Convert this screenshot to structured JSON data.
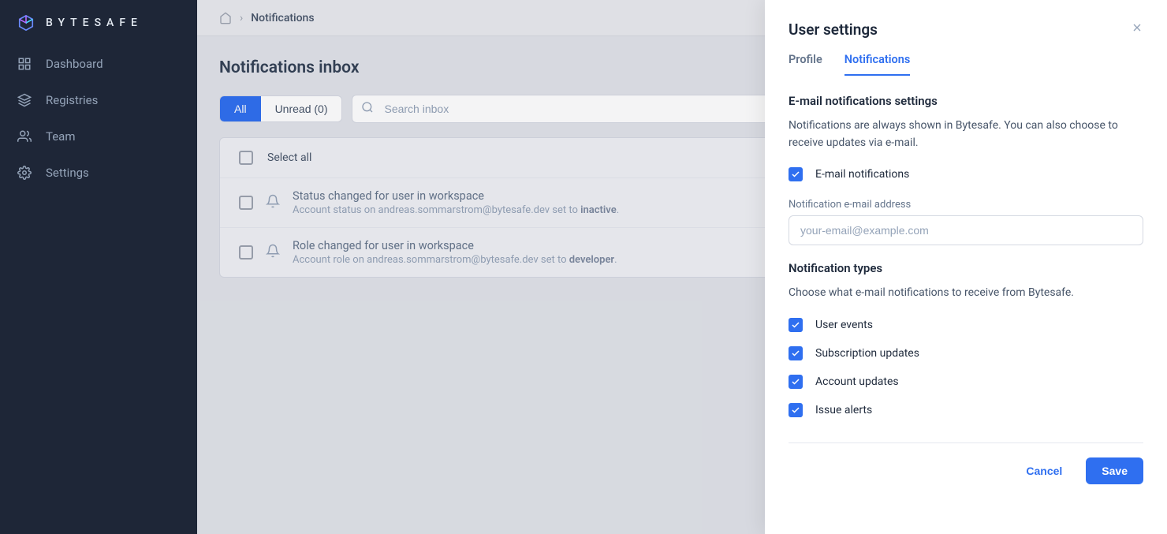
{
  "brand": "BYTESAFE",
  "sidebar": {
    "items": [
      {
        "label": "Dashboard"
      },
      {
        "label": "Registries"
      },
      {
        "label": "Team"
      },
      {
        "label": "Settings"
      }
    ]
  },
  "breadcrumb": {
    "current": "Notifications"
  },
  "page": {
    "title": "Notifications inbox",
    "filter_all": "All",
    "filter_unread": "Unread (0)",
    "search_placeholder": "Search inbox",
    "select_all": "Select all"
  },
  "notifications": [
    {
      "title": "Status changed for user in workspace",
      "desc_prefix": "Account status on andreas.sommarstrom@bytesafe.dev set to ",
      "desc_bold": "inactive",
      "desc_suffix": "."
    },
    {
      "title": "Role changed for user in workspace",
      "desc_prefix": "Account role on andreas.sommarstrom@bytesafe.dev set to ",
      "desc_bold": "developer",
      "desc_suffix": "."
    }
  ],
  "drawer": {
    "title": "User settings",
    "tabs": {
      "profile": "Profile",
      "notifications": "Notifications"
    },
    "section1_title": "E-mail notifications settings",
    "section1_desc": "Notifications are always shown in Bytesafe. You can also choose to receive updates via e-mail.",
    "email_notifications_label": "E-mail notifications",
    "email_field_label": "Notification e-mail address",
    "email_placeholder": "your-email@example.com",
    "section2_title": "Notification types",
    "section2_desc": "Choose what e-mail notifications to receive from Bytesafe.",
    "types": [
      "User events",
      "Subscription updates",
      "Account updates",
      "Issue alerts"
    ],
    "cancel": "Cancel",
    "save": "Save"
  }
}
